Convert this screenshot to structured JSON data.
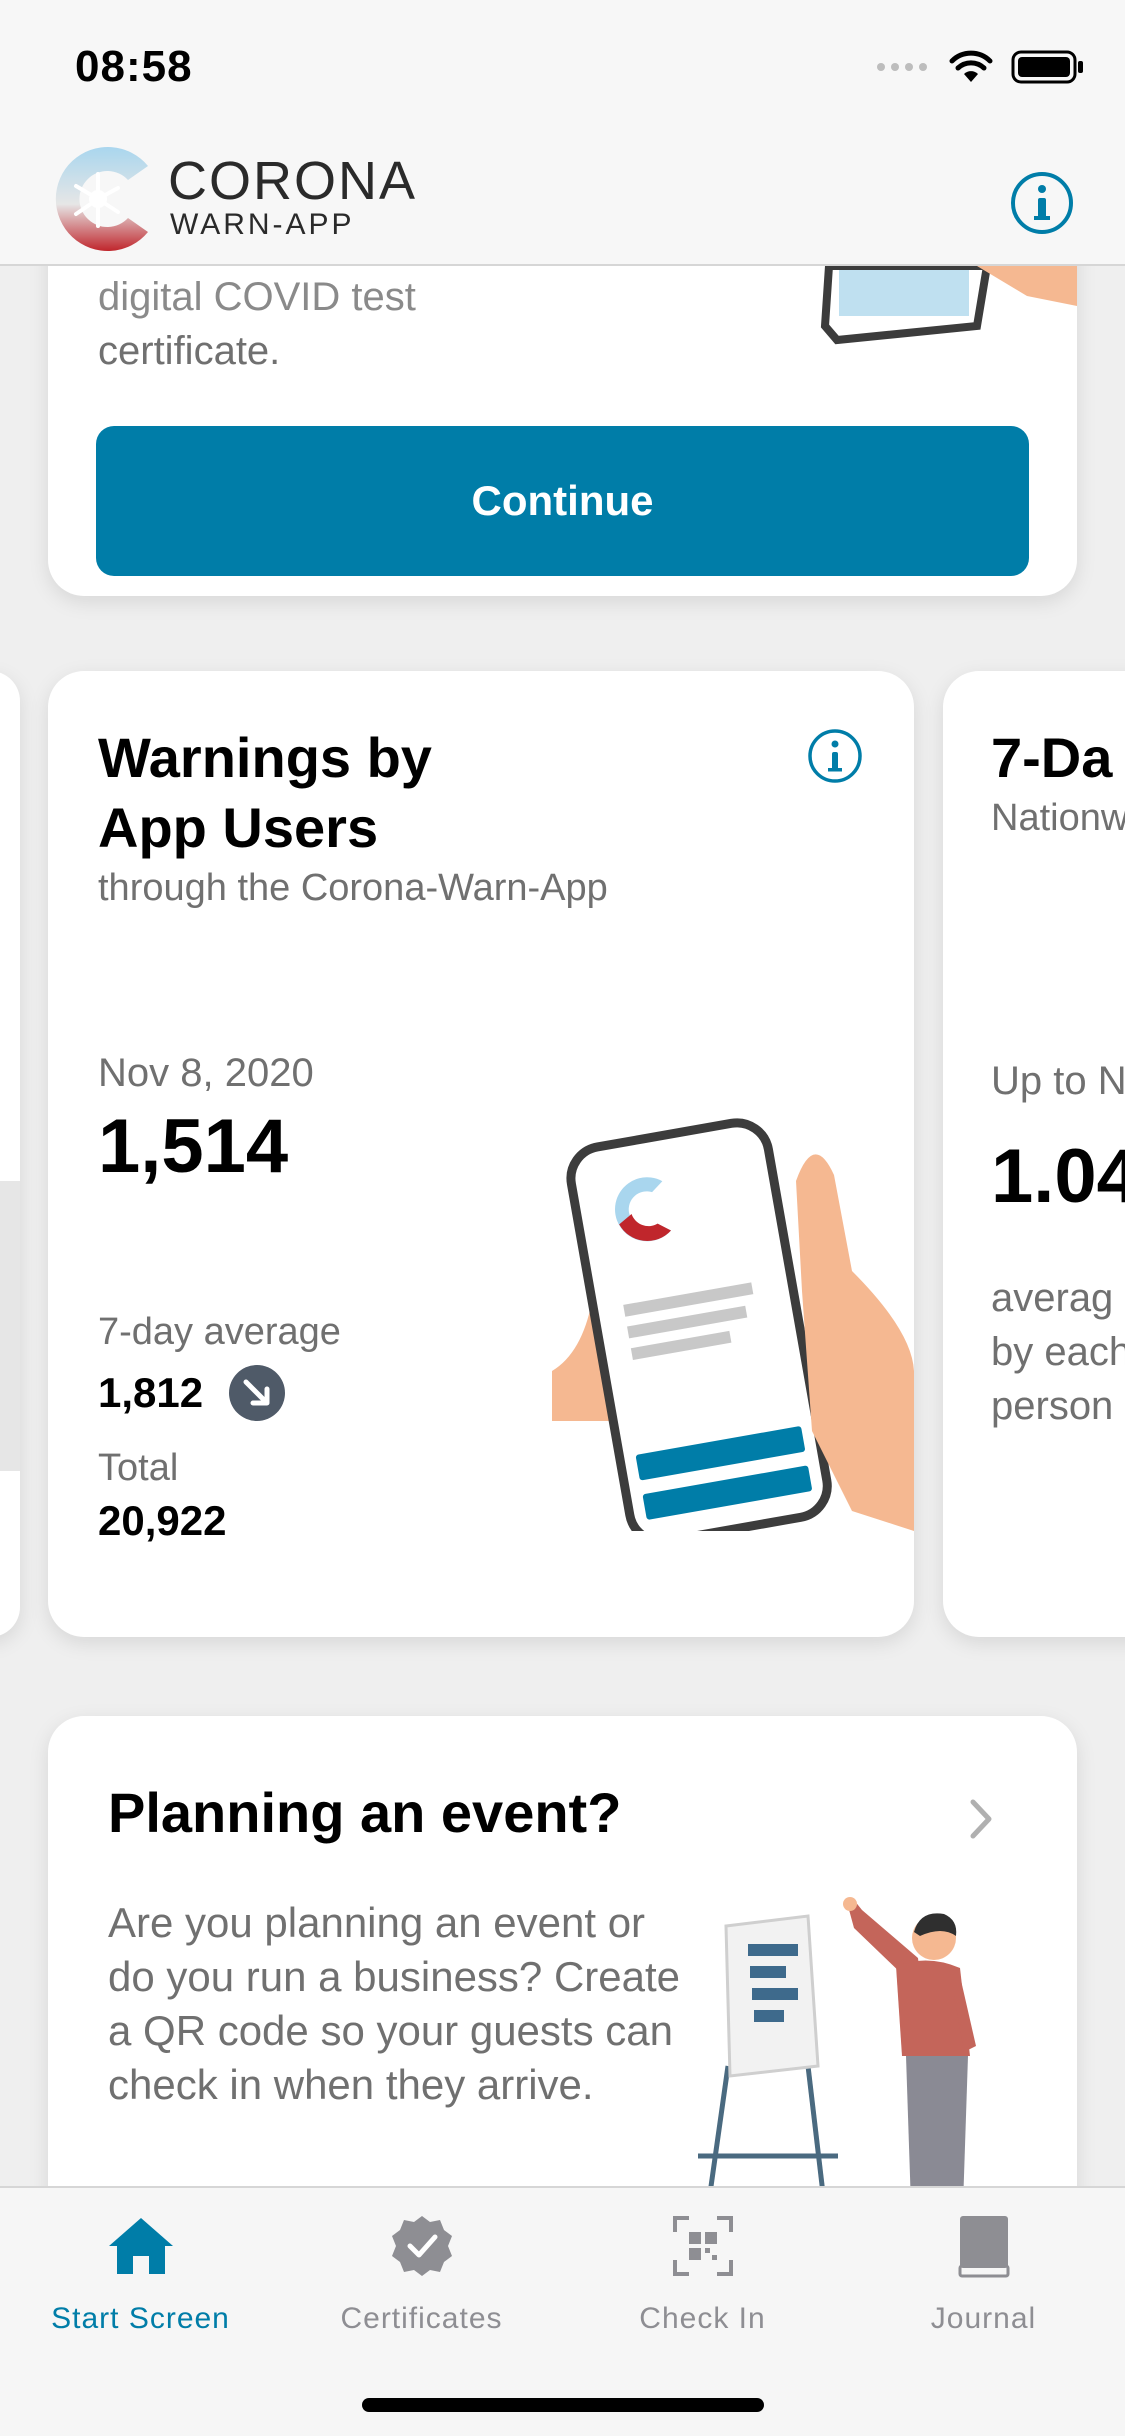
{
  "status_bar": {
    "time": "08:58"
  },
  "header": {
    "app_title": "CORONA",
    "app_subtitle": "WARN-APP",
    "info_icon": "info-circle-icon"
  },
  "test_card": {
    "text_clipped": "digital COVID test",
    "text_rest": "certificate.",
    "continue_label": "Continue"
  },
  "stats_card": {
    "title_line1": "Warnings by",
    "title_line2": "App Users",
    "subtitle": "through the Corona-Warn-App",
    "date": "Nov 8, 2020",
    "value": "1,514",
    "avg_label": "7-day average",
    "avg_value": "1,812",
    "trend": "decreasing",
    "total_label": "Total",
    "total_value": "20,922"
  },
  "stats_card_next": {
    "title": "7-Da",
    "subtitle": "Nationw",
    "upto": "Up to N",
    "value": "1.04",
    "desc_line1": "averag",
    "desc_line2": "by each",
    "desc_line3": "person"
  },
  "event_card": {
    "title": "Planning an event?",
    "text": "Are you planning an event or do you run a business? Create a QR code so your guests can check in when they arrive."
  },
  "tabs": [
    {
      "label": "Start Screen",
      "icon": "house-icon",
      "active": true
    },
    {
      "label": "Certificates",
      "icon": "certificate-badge-icon",
      "active": false
    },
    {
      "label": "Check In",
      "icon": "qr-code-icon",
      "active": false
    },
    {
      "label": "Journal",
      "icon": "book-icon",
      "active": false
    }
  ],
  "colors": {
    "accent": "#007da8",
    "background": "#efefef",
    "card": "#ffffff",
    "secondary_text": "#707070"
  }
}
